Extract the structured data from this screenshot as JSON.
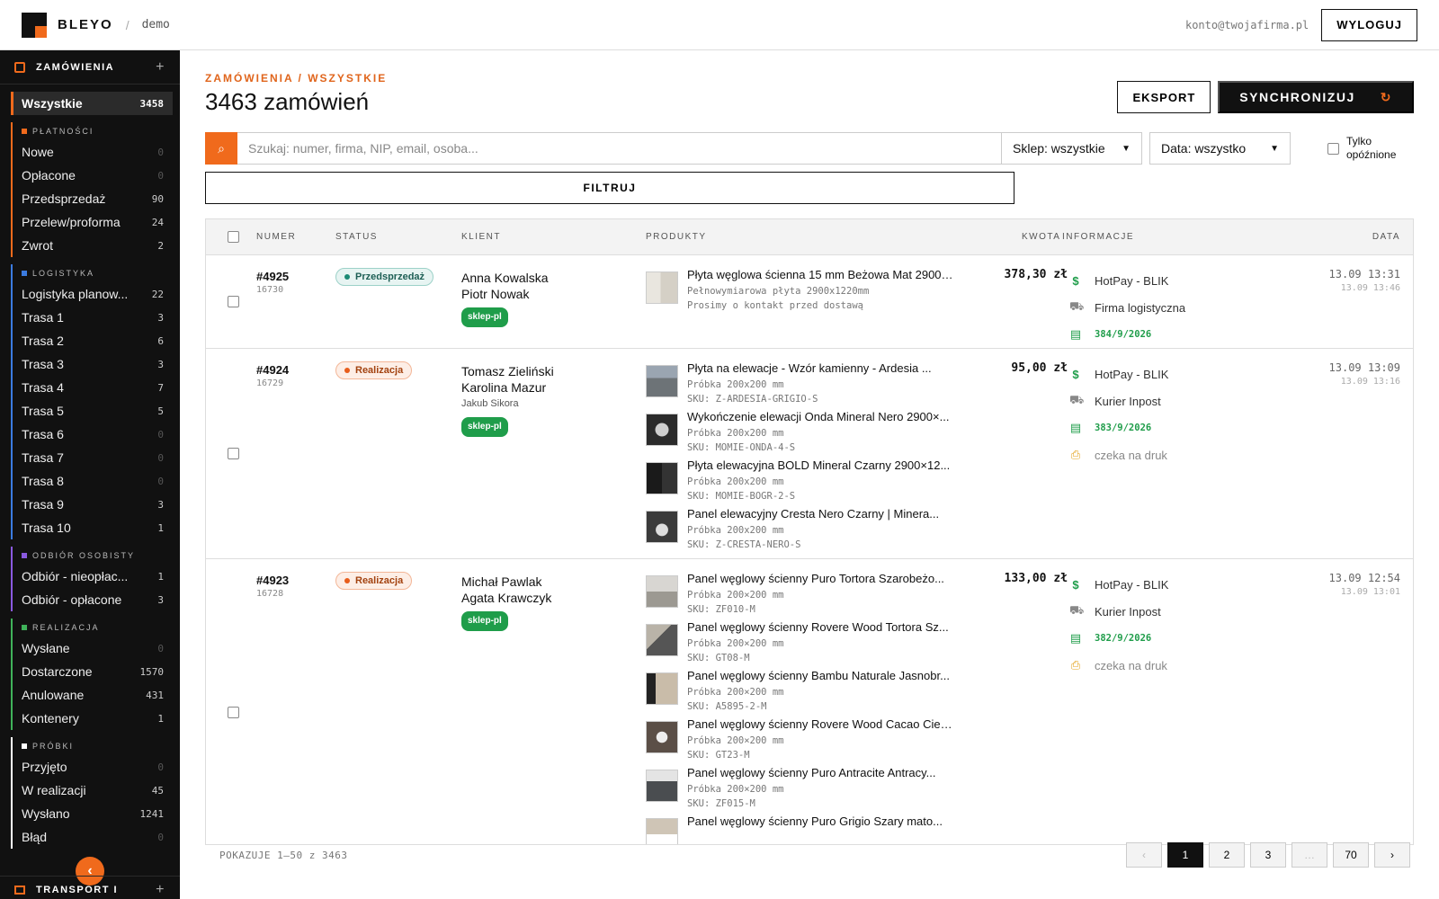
{
  "topbar": {
    "brand": "BLEYO",
    "separator": "/",
    "env": "demo",
    "account": "konto@twojafirma.pl",
    "logout_label": "WYLOGUJ"
  },
  "sidebar": {
    "section_title": "ZAMÓWIENIA",
    "plus": "+",
    "active": {
      "label": "Wszystkie",
      "count": "3458"
    },
    "groups": [
      {
        "title": "PŁATNOŚCI",
        "color": "#f06a1c",
        "items": [
          {
            "label": "Nowe",
            "count": "0"
          },
          {
            "label": "Opłacone",
            "count": "0"
          },
          {
            "label": "Przedsprzedaż",
            "count": "90"
          },
          {
            "label": "Przelew/proforma",
            "count": "24"
          },
          {
            "label": "Zwrot",
            "count": "2"
          }
        ]
      },
      {
        "title": "LOGISTYKA",
        "color": "#3b7be0",
        "items": [
          {
            "label": "Logistyka planow...",
            "count": "22"
          },
          {
            "label": "Trasa 1",
            "count": "3"
          },
          {
            "label": "Trasa 2",
            "count": "6"
          },
          {
            "label": "Trasa 3",
            "count": "3"
          },
          {
            "label": "Trasa 4",
            "count": "7"
          },
          {
            "label": "Trasa 5",
            "count": "5"
          },
          {
            "label": "Trasa 6",
            "count": "0"
          },
          {
            "label": "Trasa 7",
            "count": "0"
          },
          {
            "label": "Trasa 8",
            "count": "0"
          },
          {
            "label": "Trasa 9",
            "count": "3"
          },
          {
            "label": "Trasa 10",
            "count": "1"
          }
        ]
      },
      {
        "title": "ODBIÓR OSOBISTY",
        "color": "#8a5ae0",
        "items": [
          {
            "label": "Odbiór - nieopłac...",
            "count": "1"
          },
          {
            "label": "Odbiór - opłacone",
            "count": "3"
          }
        ]
      },
      {
        "title": "REALIZACJA",
        "color": "#3fb25a",
        "items": [
          {
            "label": "Wysłane",
            "count": "0"
          },
          {
            "label": "Dostarczone",
            "count": "1570"
          },
          {
            "label": "Anulowane",
            "count": "431"
          },
          {
            "label": "Kontenery",
            "count": "1"
          }
        ]
      },
      {
        "title": "PRÓBKI",
        "color": "#ffffff",
        "items": [
          {
            "label": "Przyjęto",
            "count": "0"
          },
          {
            "label": "W realizacji",
            "count": "45"
          },
          {
            "label": "Wysłano",
            "count": "1241"
          },
          {
            "label": "Błąd",
            "count": "0"
          }
        ]
      }
    ],
    "collapse_icon": "‹",
    "footer_title": "TRANSPORT I"
  },
  "main": {
    "breadcrumb": "ZAMÓWIENIA / WSZYSTKIE",
    "title": "3463 zamówień",
    "export_label": "EKSPORT",
    "sync_label": "SYNCHRONIZUJ",
    "sync_icon": "↻",
    "search_placeholder": "Szukaj: numer, firma, NIP, email, osoba...",
    "shop_select": "Sklep: wszystkie",
    "date_select": "Data: wszystko",
    "late_label_1": "Tylko",
    "late_label_2": "opóźnione",
    "filter_label": "FILTRUJ"
  },
  "table": {
    "headers": {
      "number": "NUMER",
      "status": "STATUS",
      "client": "KLIENT",
      "products": "PRODUKTY",
      "amount": "KWOTA",
      "info": "INFORMACJE",
      "date": "DATA"
    },
    "rows": [
      {
        "number": "#4925",
        "sub": "16730",
        "status": "Przedsprzedaż",
        "client": [
          "Anna Kowalska",
          "Piotr Nowak"
        ],
        "client_sub": "",
        "shop": "sklep-pl",
        "products": [
          {
            "name": "Płyta węglowa ścienna 15 mm Beżowa Mat 2900×...",
            "meta1": "Pełnowymiarowa płyta 2900x1220mm",
            "meta2": "Prosimy o kontakt przed dostawą"
          }
        ],
        "amount": "378,30 zł",
        "payment": "HotPay - BLIK",
        "shipping": "Firma logistyczna",
        "invoice": "384/9/2026",
        "print": "",
        "date": "13.09 13:31",
        "date2": "13.09 13:46"
      },
      {
        "number": "#4924",
        "sub": "16729",
        "status": "Realizacja",
        "client": [
          "Tomasz Zieliński",
          "Karolina Mazur"
        ],
        "client_sub": "Jakub Sikora",
        "shop": "sklep-pl",
        "products": [
          {
            "name": "Płyta na elewacje - Wzór kamienny - Ardesia ...",
            "meta1": "Próbka 200x200 mm",
            "meta2": "SKU: Z-ARDESIA-GRIGIO-S"
          },
          {
            "name": "Wykończenie elewacji Onda Mineral Nero 2900×...",
            "meta1": "Próbka 200x200 mm",
            "meta2": "SKU: MOMIE-ONDA-4-S"
          },
          {
            "name": "Płyta elewacyjna BOLD Mineral Czarny 2900×12...",
            "meta1": "Próbka 200x200 mm",
            "meta2": "SKU: MOMIE-BOGR-2-S"
          },
          {
            "name": "Panel elewacyjny Cresta Nero Czarny | Minera...",
            "meta1": "Próbka 200x200 mm",
            "meta2": "SKU: Z-CRESTA-NERO-S"
          }
        ],
        "amount": "95,00 zł",
        "payment": "HotPay - BLIK",
        "shipping": "Kurier Inpost",
        "invoice": "383/9/2026",
        "print": "czeka na druk",
        "date": "13.09 13:09",
        "date2": "13.09 13:16"
      },
      {
        "number": "#4923",
        "sub": "16728",
        "status": "Realizacja",
        "client": [
          "Michał Pawlak",
          "Agata Krawczyk"
        ],
        "client_sub": "",
        "shop": "sklep-pl",
        "products": [
          {
            "name": "Panel węglowy ścienny Puro Tortora Szarobeżo...",
            "meta1": "Próbka 200×200 mm",
            "meta2": "SKU: ZF010-M"
          },
          {
            "name": "Panel węglowy ścienny Rovere Wood Tortora Sz...",
            "meta1": "Próbka 200×200 mm",
            "meta2": "SKU: GT08-M"
          },
          {
            "name": "Panel węglowy ścienny Bambu Naturale Jasnobr...",
            "meta1": "Próbka 200×200 mm",
            "meta2": "SKU: A5895-2-M"
          },
          {
            "name": "Panel węglowy ścienny Rovere Wood Cacao Ciem...",
            "meta1": "Próbka 200×200 mm",
            "meta2": "SKU: GT23-M"
          },
          {
            "name": "Panel węglowy ścienny Puro Antracite Antracy...",
            "meta1": "Próbka 200×200 mm",
            "meta2": "SKU: ZF015-M"
          },
          {
            "name": "Panel węglowy ścienny Puro Grigio Szary mato...",
            "meta1": "",
            "meta2": ""
          }
        ],
        "amount": "133,00 zł",
        "payment": "HotPay - BLIK",
        "shipping": "Kurier Inpost",
        "invoice": "382/9/2026",
        "print": "czeka na druk",
        "date": "13.09 12:54",
        "date2": "13.09 13:01"
      }
    ]
  },
  "footer": {
    "showing": "POKAZUJE 1–50 z 3463",
    "pages": [
      "‹",
      "1",
      "2",
      "3",
      "…",
      "70",
      "›"
    ]
  }
}
